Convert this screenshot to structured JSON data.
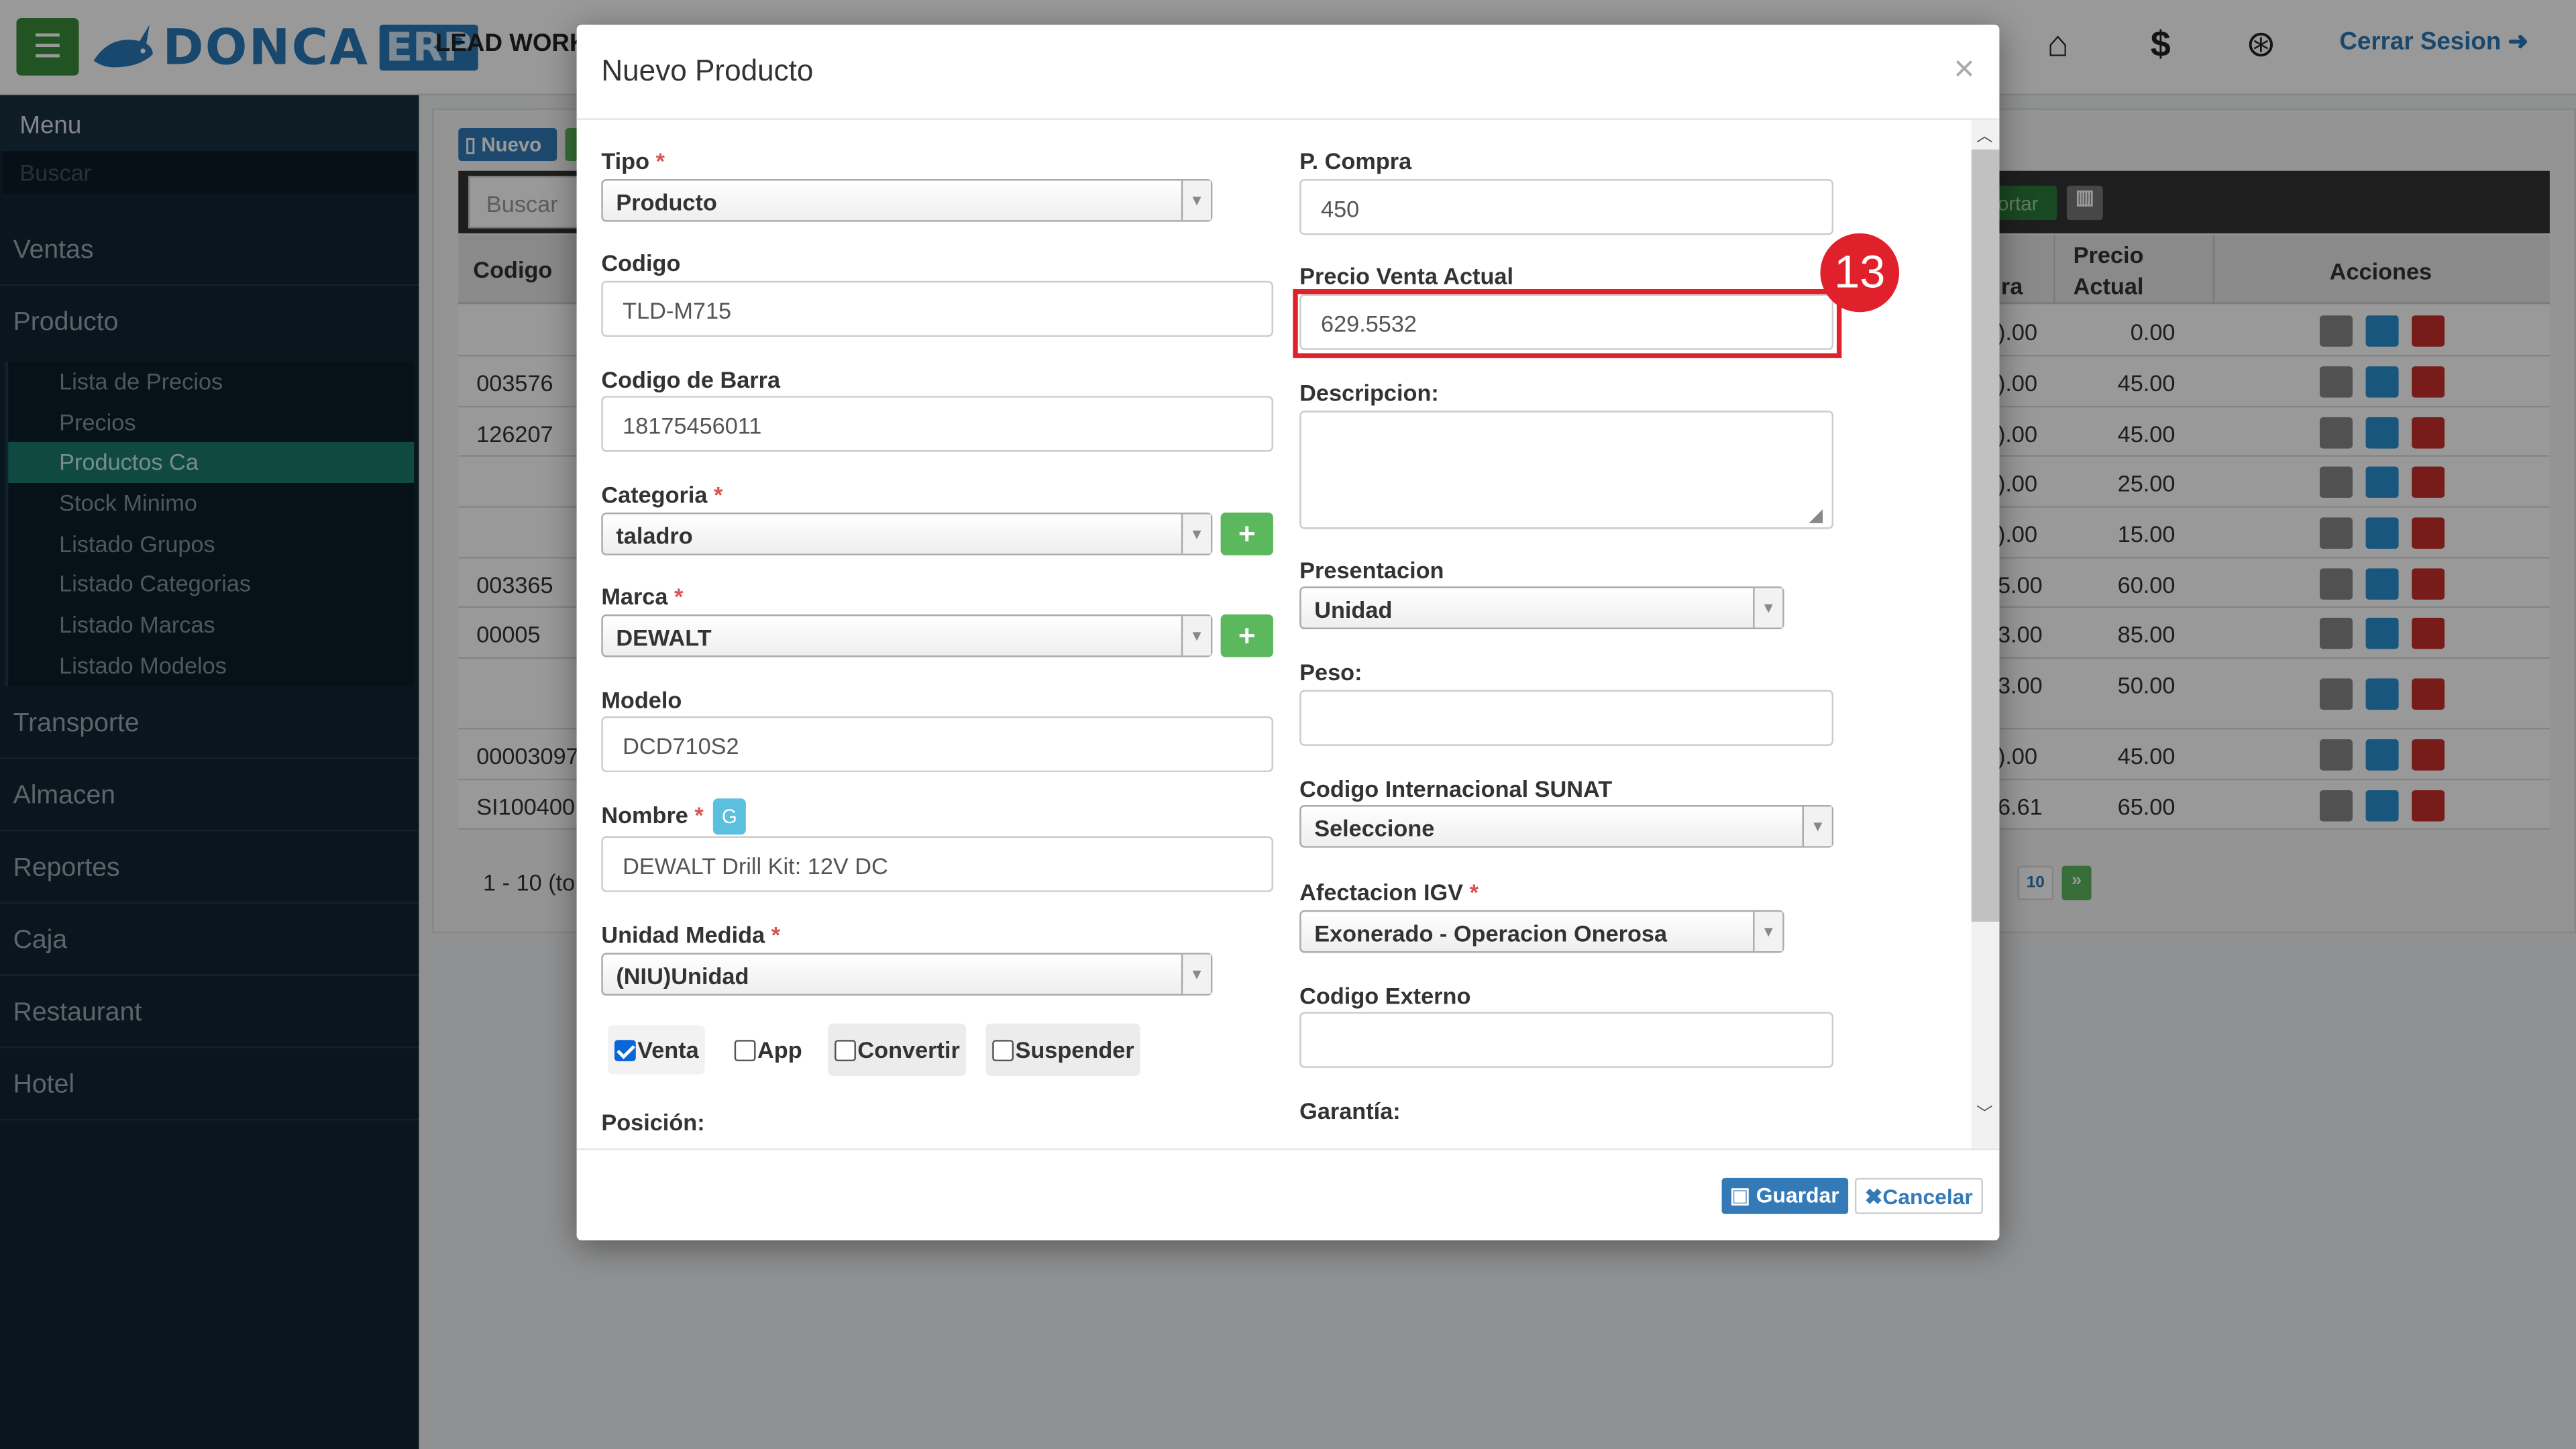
{
  "header": {
    "logo_text": "DONCA",
    "logo_badge": "ERP",
    "lead_text": "LEAD WORK",
    "logout": "Cerrar Sesion"
  },
  "sidebar": {
    "menu_title": "Menu",
    "search_placeholder": "Buscar",
    "items": [
      "Ventas",
      "Producto",
      "Transporte",
      "Almacen",
      "Reportes",
      "Caja",
      "Restaurant",
      "Hotel"
    ],
    "sub_items": [
      "Lista de Precios",
      "Precios",
      "Productos Ca",
      "Stock Minimo",
      "Listado Grupos",
      "Listado Categorias",
      "Listado Marcas",
      "Listado Modelos"
    ],
    "active_sub": "Productos Ca"
  },
  "background": {
    "nuevo_button": "Nuevo",
    "search_placeholder": "Buscar ..",
    "export_text": "ortar",
    "headers": {
      "codigo": "Codigo",
      "compra": "ra",
      "precio_actual_1": "Precio",
      "precio_actual_2": "Actual",
      "acciones": "Acciones"
    },
    "rows": [
      {
        "codigo": "",
        "compra": ").00",
        "precio": "0.00"
      },
      {
        "codigo": "003576",
        "compra": ").00",
        "precio": "45.00"
      },
      {
        "codigo": "126207",
        "compra": ").00",
        "precio": "45.00"
      },
      {
        "codigo": "",
        "compra": ").00",
        "precio": "25.00"
      },
      {
        "codigo": "",
        "compra": ").00",
        "precio": "15.00"
      },
      {
        "codigo": "003365",
        "compra": "5.00",
        "precio": "60.00"
      },
      {
        "codigo": "00005",
        "compra": "3.00",
        "precio": "85.00"
      },
      {
        "codigo": "",
        "compra": "3.00",
        "precio": "50.00"
      },
      {
        "codigo": "00003097",
        "compra": ").00",
        "precio": "45.00"
      },
      {
        "codigo": "SI100400",
        "compra": "6.61",
        "precio": "65.00"
      }
    ],
    "pagination_info": "1 - 10 (to",
    "page_number": "10",
    "next_page": "»"
  },
  "modal": {
    "title": "Nuevo Producto",
    "close": "×",
    "left": {
      "tipo_label": "Tipo",
      "tipo_value": "Producto",
      "codigo_label": "Codigo",
      "codigo_value": "TLD-M715",
      "barra_label": "Codigo de Barra",
      "barra_value": "18175456011",
      "categoria_label": "Categoria",
      "categoria_value": "taladro",
      "marca_label": "Marca",
      "marca_value": "DEWALT",
      "modelo_label": "Modelo",
      "modelo_value": "DCD710S2",
      "nombre_label": "Nombre",
      "nombre_g": "G",
      "nombre_value": "DEWALT Drill Kit: 12V DC",
      "unidad_label": "Unidad Medida",
      "unidad_value": "(NIU)Unidad",
      "checkboxes": [
        {
          "label": "Venta",
          "checked": true
        },
        {
          "label": "App",
          "checked": false
        },
        {
          "label": "Convertir",
          "checked": false
        },
        {
          "label": "Suspender",
          "checked": false
        }
      ],
      "posicion_label": "Posición:"
    },
    "right": {
      "compra_label": "P. Compra",
      "compra_value": "450",
      "venta_label": "Precio Venta Actual",
      "venta_value": "629.5532",
      "descripcion_label": "Descripcion:",
      "descripcion_value": "",
      "presentacion_label": "Presentacion",
      "presentacion_value": "Unidad",
      "peso_label": "Peso:",
      "peso_value": "",
      "sunat_label": "Codigo Internacional SUNAT",
      "sunat_value": "Seleccione",
      "igv_label": "Afectacion IGV",
      "igv_value": "Exonerado - Operacion Onerosa",
      "externo_label": "Codigo Externo",
      "externo_value": "",
      "garantia_label": "Garantía:"
    },
    "footer": {
      "save": "Guardar",
      "cancel": "Cancelar"
    }
  },
  "annotation": {
    "step": "13",
    "color": "#e0202a"
  },
  "colors": {
    "brand": "#2a79b8",
    "success": "#5cb85c",
    "danger": "#d9534f",
    "sidebar": "#102532",
    "active": "#1b7a6c"
  }
}
